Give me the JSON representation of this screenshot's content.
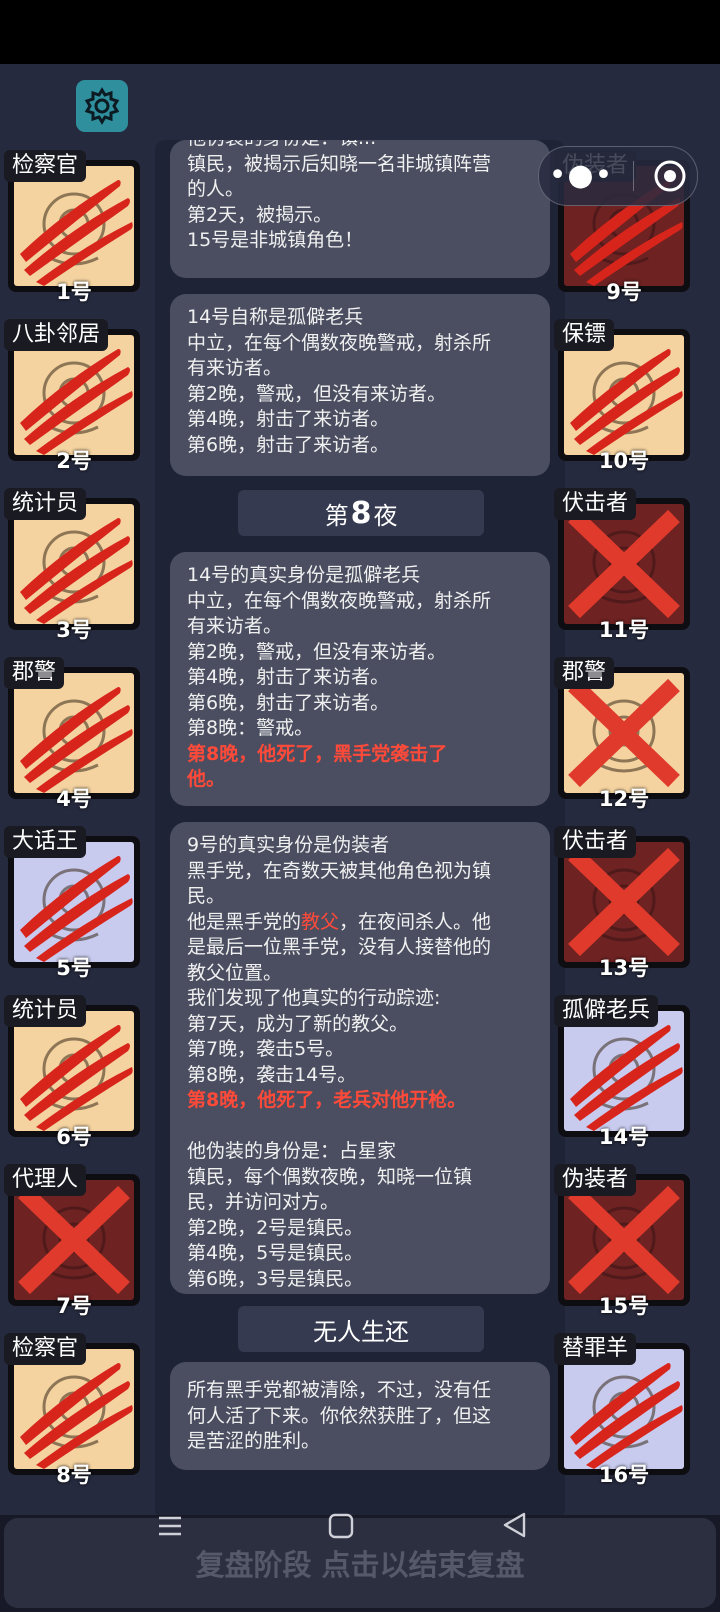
{
  "colors": {
    "background": "#262a3e",
    "card": "#4a4e60",
    "accent_red": "#ff4a3a",
    "tan": "#f4d3a0",
    "lavender": "#c9cbee",
    "maroon": "#6e2222"
  },
  "settings_icon": "gear-icon",
  "capsule": {
    "more_icon": "more-dots-icon",
    "close_icon": "target-close-icon"
  },
  "cards": [
    {
      "lines": [
        "他伪装的身份是：镇...",
        "镇民，被揭示后知晓一名非城镇阵营",
        "的人。",
        "第2天，被揭示。",
        "15号是非城镇角色！"
      ]
    },
    {
      "lines": [
        "14号自称是孤僻老兵",
        "中立，在每个偶数夜晚警戒，射杀所",
        "有来访者。",
        "第2晚，警戒，但没有来访者。",
        "第4晚，射击了来访者。",
        "第6晚，射击了来访者。"
      ]
    },
    {
      "lines": [
        "14号的真实身份是孤僻老兵",
        "中立，在每个偶数夜晚警戒，射杀所",
        "有来访者。",
        "第2晚，警戒，但没有来访者。",
        "第4晚，射击了来访者。",
        "第6晚，射击了来访者。",
        "第8晚：警戒。"
      ],
      "red_lines": [
        "第8晚，他死了，黑手党袭击了",
        "他。"
      ]
    },
    {
      "lines_a": [
        "9号的真实身份是伪装者",
        "黑手党，在奇数天被其他角色视为镇",
        "民。"
      ],
      "line_hl_pre": "他是黑手党的",
      "line_hl": "教父",
      "line_hl_post": "，在夜间杀人。他",
      "lines_b": [
        "是最后一位黑手党，没有人接替他的",
        "教父位置。",
        "我们发现了他真实的行动踪迹:",
        "第7天，成为了新的教父。",
        "第7晚，袭击5号。",
        "第8晚，袭击14号。"
      ],
      "red_lines": [
        "第8晚，他死了，老兵对他开枪。"
      ],
      "lines_c": [
        "",
        "他伪装的身份是：占星家",
        "镇民，每个偶数夜晚，知晓一位镇",
        "民，并访问对方。",
        "第2晚，2号是镇民。",
        "第4晚，5号是镇民。",
        "第6晚，3号是镇民。"
      ]
    },
    {
      "lines": [
        "所有黑手党都被清除，不过，没有任",
        "何人活了下来。你依然获胜了，但这",
        "是苦涩的胜利。"
      ]
    }
  ],
  "headers": {
    "night_pre": "第",
    "night_num": "8",
    "night_post": "夜",
    "no_survivors": "无人生还"
  },
  "players_left": [
    {
      "role": "检察官",
      "num": "1号",
      "bg": "#f4d3a0",
      "mark": "claw",
      "icon": "prosecutor-icon"
    },
    {
      "role": "八卦邻居",
      "num": "2号",
      "bg": "#f4d3a0",
      "mark": "claw",
      "icon": "neighbor-icon"
    },
    {
      "role": "统计员",
      "num": "3号",
      "bg": "#f4d3a0",
      "mark": "claw",
      "icon": "statistician-icon"
    },
    {
      "role": "郡警",
      "num": "4号",
      "bg": "#f4d3a0",
      "mark": "claw",
      "icon": "sheriff-icon"
    },
    {
      "role": "大话王",
      "num": "5号",
      "bg": "#c9cbee",
      "mark": "claw",
      "icon": "braggart-icon"
    },
    {
      "role": "统计员",
      "num": "6号",
      "bg": "#f4d3a0",
      "mark": "claw",
      "icon": "statistician-icon"
    },
    {
      "role": "代理人",
      "num": "7号",
      "bg": "#6e2222",
      "mark": "x",
      "icon": "agent-icon"
    },
    {
      "role": "检察官",
      "num": "8号",
      "bg": "#f4d3a0",
      "mark": "claw",
      "icon": "prosecutor-icon"
    }
  ],
  "players_right": [
    {
      "role": "伪装者",
      "num": "9号",
      "bg": "#6e2222",
      "mark": "claw",
      "icon": "disguiser-icon"
    },
    {
      "role": "保镖",
      "num": "10号",
      "bg": "#f4d3a0",
      "mark": "claw",
      "icon": "bodyguard-icon"
    },
    {
      "role": "伏击者",
      "num": "11号",
      "bg": "#6e2222",
      "mark": "x",
      "icon": "ambusher-icon"
    },
    {
      "role": "郡警",
      "num": "12号",
      "bg": "#f4d3a0",
      "mark": "x",
      "icon": "sheriff-icon"
    },
    {
      "role": "伏击者",
      "num": "13号",
      "bg": "#6e2222",
      "mark": "x",
      "icon": "ambusher-icon"
    },
    {
      "role": "孤僻老兵",
      "num": "14号",
      "bg": "#c9cbee",
      "mark": "claw",
      "icon": "veteran-icon"
    },
    {
      "role": "伪装者",
      "num": "15号",
      "bg": "#6e2222",
      "mark": "x",
      "icon": "disguiser-icon"
    },
    {
      "role": "替罪羊",
      "num": "16号",
      "bg": "#c9cbee",
      "mark": "claw",
      "icon": "scapegoat-icon"
    }
  ],
  "end_button": "复盘阶段 点击以结束复盘",
  "nav": {
    "menu_icon": "menu-nav-icon",
    "home_icon": "home-nav-icon",
    "back_icon": "back-nav-icon"
  }
}
